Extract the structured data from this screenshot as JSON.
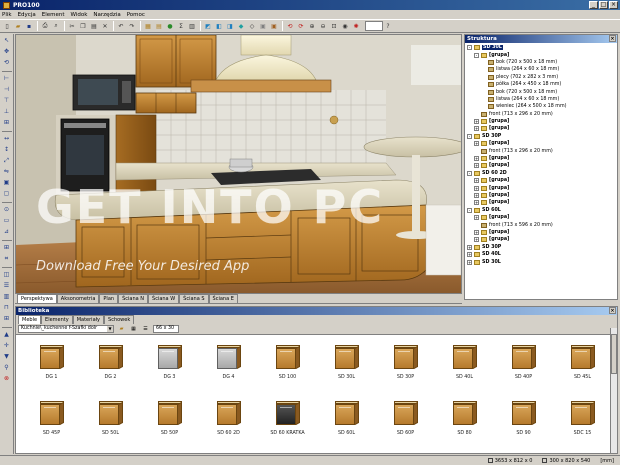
{
  "window": {
    "title": "PRO100"
  },
  "menu": [
    "Plik",
    "Edycja",
    "Element",
    "Widok",
    "Narzędzia",
    "Pomoc"
  ],
  "toolbar": {
    "zoom_value": ""
  },
  "viewport": {
    "watermark_title": "GET INTO PC",
    "watermark_sub": "Download Free Your Desired App"
  },
  "view_tabs": [
    "Perspektywa",
    "Aksonometria",
    "Plan",
    "Ściana N",
    "Ściana W",
    "Ściana S",
    "Ściana E"
  ],
  "structure": {
    "title": "Struktura",
    "rows": [
      {
        "label": "SD 30L",
        "expander": "-",
        "icon": "folder",
        "indent": 0,
        "selected": true
      },
      {
        "label": "[grupa]",
        "expander": "-",
        "icon": "folder",
        "indent": 1,
        "bold": true
      },
      {
        "label": "bok   (720 x 500 x 18 mm)",
        "expander": "",
        "icon": "part",
        "indent": 2
      },
      {
        "label": "listwa   (264 x 60 x 18 mm)",
        "expander": "",
        "icon": "part",
        "indent": 2
      },
      {
        "label": "plecy   (702 x 282 x 3 mm)",
        "expander": "",
        "icon": "part",
        "indent": 2
      },
      {
        "label": "półka   (264 x 450 x 18 mm)",
        "expander": "",
        "icon": "part",
        "indent": 2
      },
      {
        "label": "bok   (720 x 500 x 18 mm)",
        "expander": "",
        "icon": "part",
        "indent": 2
      },
      {
        "label": "listwa   (264 x 60 x 18 mm)",
        "expander": "",
        "icon": "part",
        "indent": 2
      },
      {
        "label": "wieniec   (264 x 500 x 18 mm)",
        "expander": "",
        "icon": "part",
        "indent": 2
      },
      {
        "label": "front   (713 x 296 x 20 mm)",
        "expander": "",
        "icon": "part",
        "indent": 1
      },
      {
        "label": "[grupa]",
        "expander": "+",
        "icon": "folder",
        "indent": 1,
        "bold": true
      },
      {
        "label": "[grupa]",
        "expander": "+",
        "icon": "folder",
        "indent": 1,
        "bold": true
      },
      {
        "label": "SD 30P",
        "expander": "-",
        "icon": "folder",
        "indent": 0,
        "bold": true
      },
      {
        "label": "[grupa]",
        "expander": "+",
        "icon": "folder",
        "indent": 1,
        "bold": true
      },
      {
        "label": "front   (713 x 296 x 20 mm)",
        "expander": "",
        "icon": "part",
        "indent": 1
      },
      {
        "label": "[grupa]",
        "expander": "+",
        "icon": "folder",
        "indent": 1,
        "bold": true
      },
      {
        "label": "[grupa]",
        "expander": "+",
        "icon": "folder",
        "indent": 1,
        "bold": true
      },
      {
        "label": "SD 60 2D",
        "expander": "-",
        "icon": "folder",
        "indent": 0,
        "bold": true
      },
      {
        "label": "[grupa]",
        "expander": "+",
        "icon": "folder",
        "indent": 1,
        "bold": true
      },
      {
        "label": "[grupa]",
        "expander": "+",
        "icon": "folder",
        "indent": 1,
        "bold": true
      },
      {
        "label": "[grupa]",
        "expander": "+",
        "icon": "folder",
        "indent": 1,
        "bold": true
      },
      {
        "label": "[grupa]",
        "expander": "+",
        "icon": "folder",
        "indent": 1,
        "bold": true
      },
      {
        "label": "SD 60L",
        "expander": "-",
        "icon": "folder",
        "indent": 0,
        "bold": true
      },
      {
        "label": "[grupa]",
        "expander": "+",
        "icon": "folder",
        "indent": 1,
        "bold": true
      },
      {
        "label": "front   (713 x 596 x 20 mm)",
        "expander": "",
        "icon": "part",
        "indent": 1
      },
      {
        "label": "[grupa]",
        "expander": "+",
        "icon": "folder",
        "indent": 1,
        "bold": true
      },
      {
        "label": "[grupa]",
        "expander": "+",
        "icon": "folder",
        "indent": 1,
        "bold": true
      },
      {
        "label": "SD 30P",
        "expander": "+",
        "icon": "folder",
        "indent": 0,
        "bold": true
      },
      {
        "label": "SD 40L",
        "expander": "+",
        "icon": "folder",
        "indent": 0,
        "bold": true
      },
      {
        "label": "SD 30L",
        "expander": "+",
        "icon": "folder",
        "indent": 0,
        "bold": true
      }
    ]
  },
  "library": {
    "title": "Biblioteka",
    "tabs": [
      "Meble",
      "Elementy",
      "Materiały",
      "Schowek"
    ],
    "active_tab": 0,
    "path": "Kuchnie\\_kuchenne f-Szafki dolr",
    "size": "66 x 30",
    "items": [
      {
        "label": "DG 1",
        "style": "wood"
      },
      {
        "label": "DG 2",
        "style": "wood"
      },
      {
        "label": "DG 3",
        "style": "grey"
      },
      {
        "label": "DG 4",
        "style": "grey"
      },
      {
        "label": "SD 100",
        "style": "wood"
      },
      {
        "label": "SD 30L",
        "style": "wood"
      },
      {
        "label": "SD 30P",
        "style": "wood"
      },
      {
        "label": "SD 40L",
        "style": "wood"
      },
      {
        "label": "SD 40P",
        "style": "wood"
      },
      {
        "label": "SD 45L",
        "style": "wood"
      },
      {
        "label": "SD 45P",
        "style": "wood"
      },
      {
        "label": "SD 50L",
        "style": "wood"
      },
      {
        "label": "SD 50P",
        "style": "wood"
      },
      {
        "label": "SD 60 2D",
        "style": "wood"
      },
      {
        "label": "SD 60 KRATKA",
        "style": "dark"
      },
      {
        "label": "SD 60L",
        "style": "wood"
      },
      {
        "label": "SD 60P",
        "style": "wood"
      },
      {
        "label": "SD 80",
        "style": "wood"
      },
      {
        "label": "SD 90",
        "style": "wood"
      },
      {
        "label": "SDC 15",
        "style": "wood"
      }
    ]
  },
  "status": {
    "dims": "3653 x 812 x 0",
    "size": "300 x 820 x 540",
    "unit": "[mm]"
  },
  "colors": {
    "title_bar": "#0a246a",
    "cabinet_wood": "#c48a3c",
    "selection": "#0a246a"
  }
}
